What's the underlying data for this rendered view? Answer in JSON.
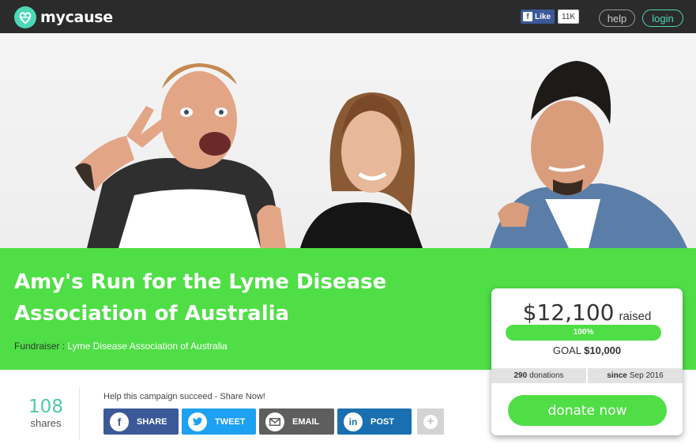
{
  "header": {
    "logo_text": "mycause",
    "fb_like_label": "Like",
    "fb_count": "11K",
    "help_label": "help",
    "login_label": "login",
    "accent_color": "#4cd8b6"
  },
  "hero": {
    "image": "photo-of-three-people"
  },
  "campaign": {
    "title": "Amy's Run for the Lyme Disease Association of Australia",
    "fundraiser_label": "Fundraiser :",
    "fundraiser_org": "Lyme Disease Association of Australia",
    "band_color": "#4fde46"
  },
  "stats": {
    "raised_amount": "$12,100",
    "raised_label": "raised",
    "progress_percent": 100,
    "progress_text": "100%",
    "goal_label": "GOAL",
    "goal_amount": "$10,000",
    "donations_count": "290",
    "donations_label": "donations",
    "since_label": "since",
    "since_date": "Sep 2016",
    "donate_label": "donate now"
  },
  "shares": {
    "count": "108",
    "label": "shares",
    "prompt": "Help this campaign succeed - Share Now!",
    "buttons": [
      {
        "label": "SHARE",
        "icon": "facebook-icon",
        "color": "#3b5998"
      },
      {
        "label": "TWEET",
        "icon": "twitter-icon",
        "color": "#1da1f2"
      },
      {
        "label": "EMAIL",
        "icon": "email-icon",
        "color": "#5e5e5e"
      },
      {
        "label": "POST",
        "icon": "linkedin-icon",
        "color": "#1a6fb0"
      }
    ],
    "more_icon": "plus-icon"
  }
}
